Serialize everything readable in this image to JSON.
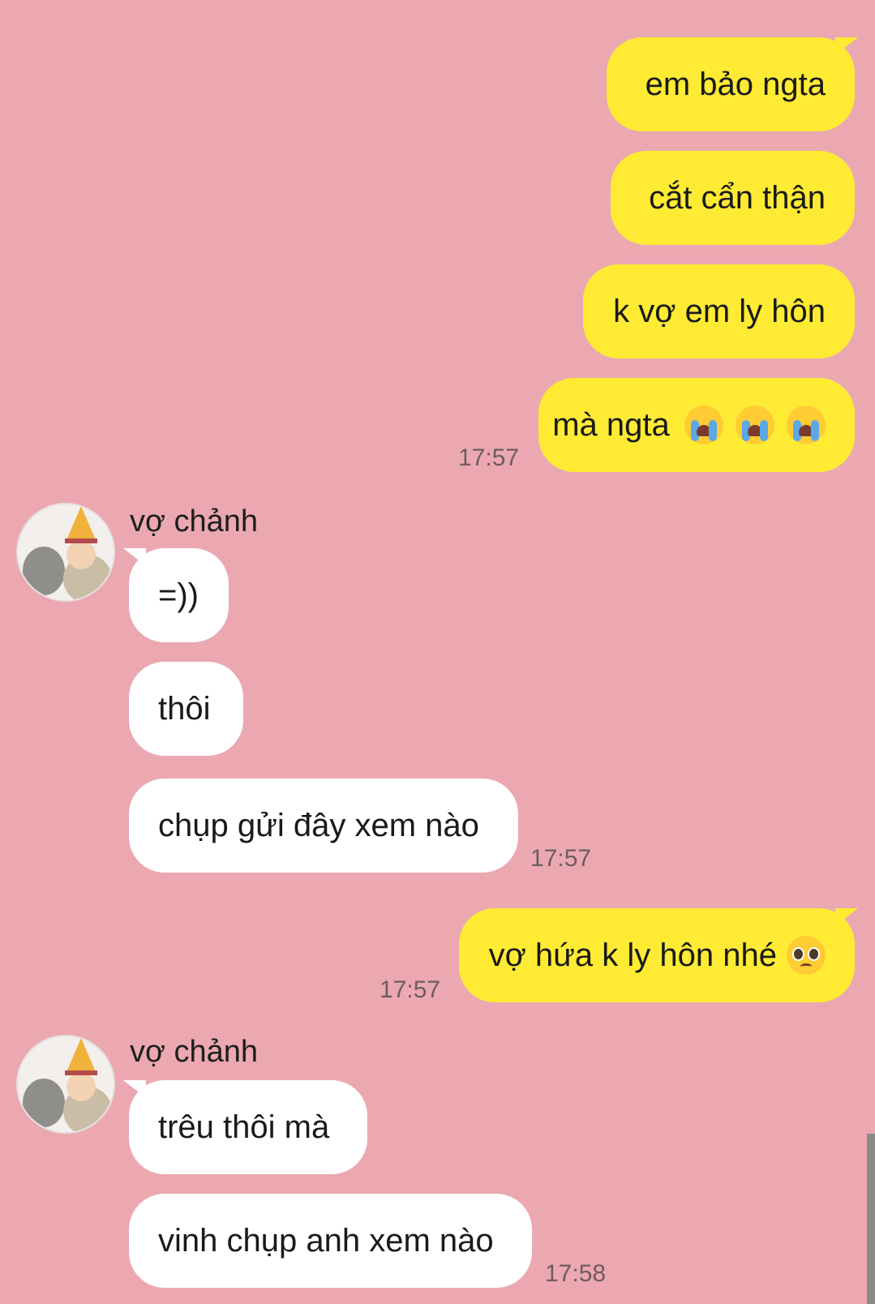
{
  "messages": {
    "out1": "em bảo ngta",
    "out2": "cắt cẩn thận",
    "out3": "k vợ em ly hôn",
    "out4": "mà ngta",
    "out5": "vợ hứa k ly hôn nhé",
    "in1": "=))",
    "in2": "thôi",
    "in3": "chụp gửi đây xem nào",
    "in4": "trêu thôi mà",
    "in5": "vinh chụp anh xem nào"
  },
  "times": {
    "t1": "17:57",
    "t2": "17:57",
    "t3": "17:57",
    "t4": "17:58"
  },
  "contact": {
    "name1": "vợ chảnh",
    "name2": "vợ chảnh"
  },
  "icons": {
    "crying": "loudly-crying-face-icon",
    "pleading": "pleading-face-icon"
  },
  "colors": {
    "background": "#eba8b1",
    "outgoing_bubble": "#ffeb34",
    "incoming_bubble": "#ffffff"
  }
}
